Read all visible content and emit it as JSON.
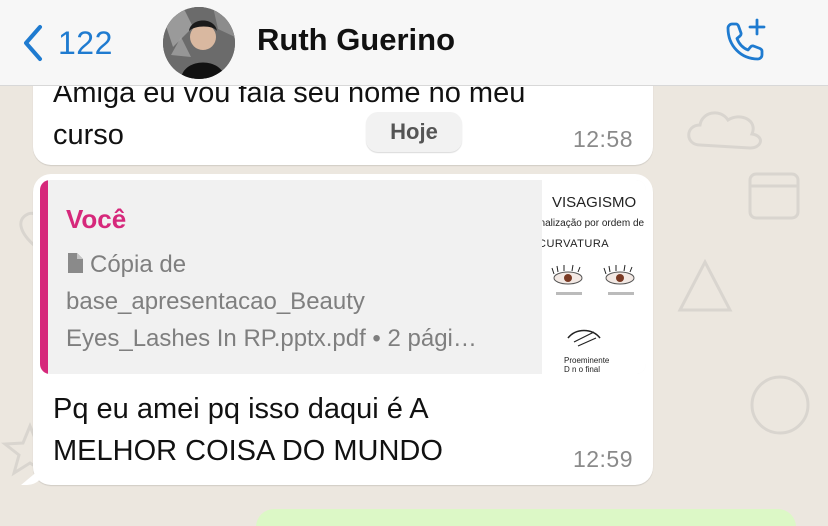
{
  "header": {
    "back_count": "122",
    "contact_name": "Ruth Guerino",
    "back_icon": "chevron-left-icon",
    "call_icon": "phone-plus-icon"
  },
  "date_chip": "Hoje",
  "messages": [
    {
      "text_line1": "Amiga eu vou fala seu nome no meu",
      "text_line2": "curso",
      "time": "12:58"
    },
    {
      "reply": {
        "author": "Você",
        "doc_line1": "Cópia de",
        "doc_line2": "base_apresentacao_Beauty",
        "doc_line3": "Eyes_Lashes In RP.pptx.pdf • 2 pági…",
        "doc_icon": "document-icon",
        "thumbnail": {
          "title": "VISAGISMO",
          "subtitle": "onalização por ordem de",
          "heading": "CURVATURA",
          "caption_bottom1": "Proeminente",
          "caption_bottom2": "D n o final"
        }
      },
      "text_line1": "Pq eu amei pq isso daqui é A",
      "text_line2": "MELHOR COISA DO MUNDO",
      "time": "12:59"
    }
  ],
  "colors": {
    "accent": "#1f7bd0",
    "reply_author": "#d6287b",
    "outgoing_bubble": "#dcf8c6",
    "wallpaper": "#ece7df"
  }
}
